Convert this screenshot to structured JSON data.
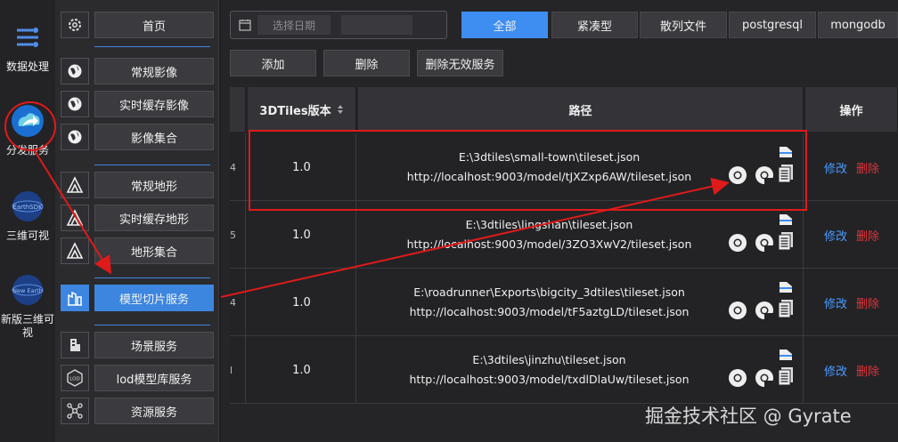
{
  "rail": {
    "items": [
      {
        "label": "数据处理",
        "icon": "data-processing-icon"
      },
      {
        "label": "分发服务",
        "icon": "cloud-share-icon"
      },
      {
        "label": "三维可视",
        "icon": "earthsdk-globe-icon",
        "badge": "EarthSDK"
      },
      {
        "label": "新版三维可视",
        "icon": "new-earth-globe-icon",
        "badge": "New Earth"
      }
    ]
  },
  "menu": {
    "items": [
      {
        "label": "首页",
        "icon": "gear-icon"
      },
      {
        "label": "常规影像",
        "icon": "globe-icon"
      },
      {
        "label": "实时缓存影像",
        "icon": "globe-icon"
      },
      {
        "label": "影像集合",
        "icon": "globe-icon"
      },
      {
        "label": "常规地形",
        "icon": "mountain-icon"
      },
      {
        "label": "实时缓存地形",
        "icon": "mountain-icon"
      },
      {
        "label": "地形集合",
        "icon": "mountain-icon"
      },
      {
        "label": "模型切片服务",
        "icon": "model-tiles-icon"
      },
      {
        "label": "场景服务",
        "icon": "building-icon"
      },
      {
        "label": "lod模型库服务",
        "icon": "lod-icon",
        "icon_text": "LOD"
      },
      {
        "label": "资源服务",
        "icon": "network-nodes-icon"
      }
    ],
    "active_index": 7
  },
  "toolbar": {
    "date_placeholder": "选择日期",
    "tabs": [
      "全部",
      "紧凑型",
      "散列文件",
      "postgresql",
      "mongodb"
    ],
    "active_tab": 0,
    "add": "添加",
    "delete": "删除",
    "delete_invalid": "删除无效服务"
  },
  "table": {
    "headers": {
      "version": "3DTiles版本",
      "path": "路径",
      "ops": "操作"
    },
    "rows": [
      {
        "stub": "4",
        "version": "1.0",
        "path": "E:\\3dtiles\\small-town\\tileset.json",
        "url": "http://localhost:9003/model/tJXZxp6AW/tileset.json",
        "edit": "修改",
        "del": "删除"
      },
      {
        "stub": "5",
        "version": "1.0",
        "path": "E:\\3dtiles\\lingshan\\tileset.json",
        "url": "http://localhost:9003/model/3ZO3XwV2/tileset.json",
        "edit": "修改",
        "del": "删除"
      },
      {
        "stub": "4",
        "version": "1.0",
        "path": "E:\\roadrunner\\Exports\\bigcity_3dtiles\\tileset.json",
        "url": "http://localhost:9003/model/tF5aztgLD/tileset.json",
        "edit": "修改",
        "del": "删除"
      },
      {
        "stub": "l",
        "version": "1.0",
        "path": "E:\\3dtiles\\jinzhu\\tileset.json",
        "url": "http://localhost:9003/model/txdlDlaUw/tileset.json",
        "edit": "修改",
        "del": "删除"
      }
    ]
  },
  "watermark": "掘金技术社区 @ Gyrate",
  "colors": {
    "accent": "#3d8ef0",
    "danger": "#e0343a",
    "annotation": "#e01a1a"
  }
}
